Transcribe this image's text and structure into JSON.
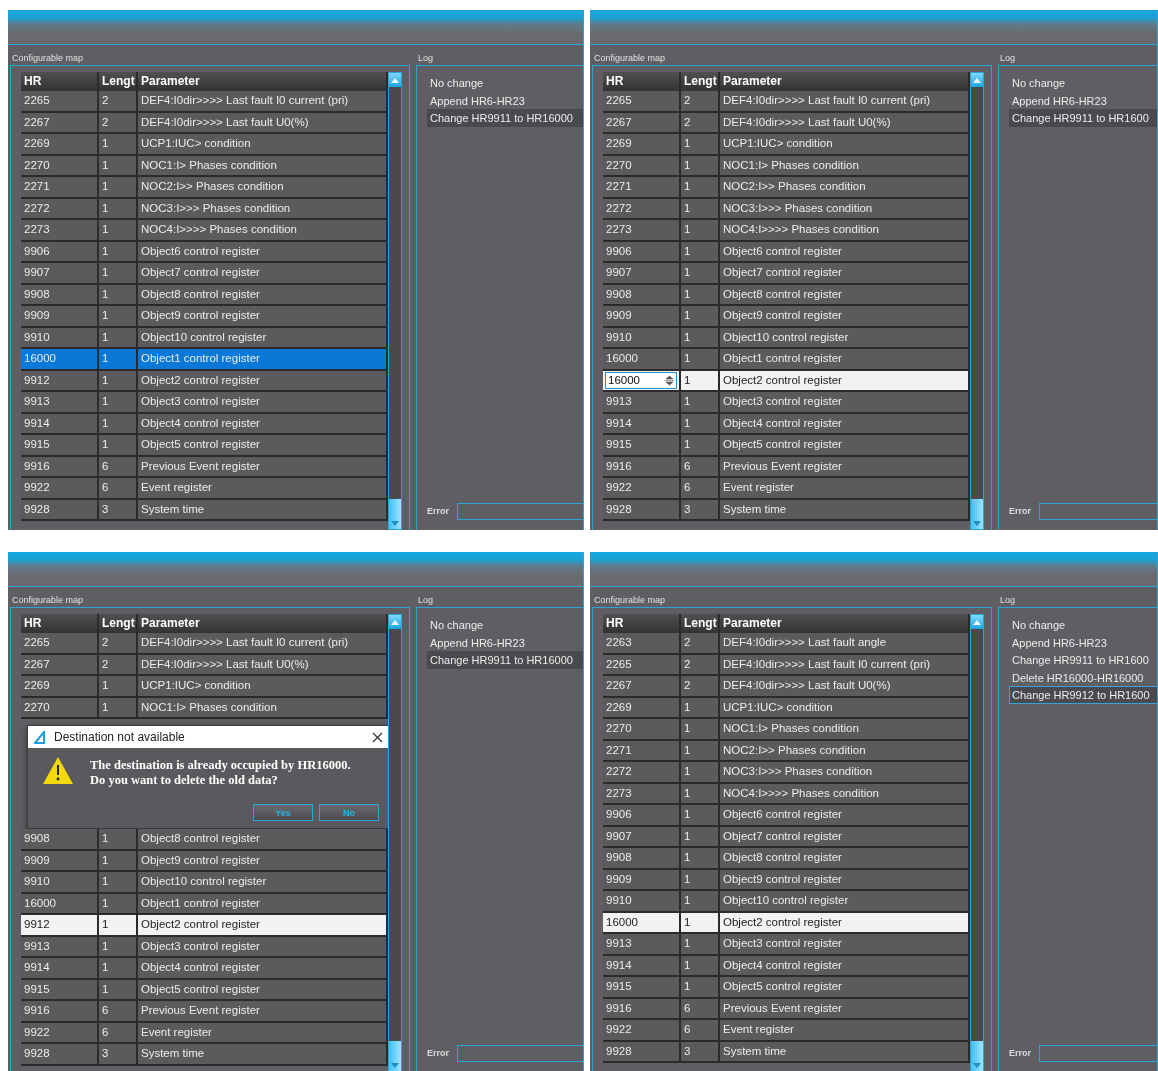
{
  "panels": [
    {
      "map_label": "Configurable map",
      "log_label": "Log",
      "table_focused": true,
      "log_focused": false,
      "error_label": "Error",
      "table": {
        "columns": [
          "HR",
          "Lengt",
          "Parameter"
        ],
        "rows": [
          {
            "kind": "row",
            "hr": "2265",
            "length": "2",
            "parameter": "DEF4:I0dir>>>> Last fault I0 current (pri)",
            "selected": false
          },
          {
            "kind": "row",
            "hr": "2267",
            "length": "2",
            "parameter": "DEF4:I0dir>>>> Last fault U0(%)",
            "selected": false
          },
          {
            "kind": "row",
            "hr": "2269",
            "length": "1",
            "parameter": "UCP1:IUC> condition",
            "selected": false
          },
          {
            "kind": "row",
            "hr": "2270",
            "length": "1",
            "parameter": "NOC1:I> Phases condition",
            "selected": false
          },
          {
            "kind": "row",
            "hr": "2271",
            "length": "1",
            "parameter": "NOC2:I>> Phases condition",
            "selected": false
          },
          {
            "kind": "row",
            "hr": "2272",
            "length": "1",
            "parameter": "NOC3:I>>> Phases condition",
            "selected": false
          },
          {
            "kind": "row",
            "hr": "2273",
            "length": "1",
            "parameter": "NOC4:I>>>> Phases condition",
            "selected": false
          },
          {
            "kind": "row",
            "hr": "9906",
            "length": "1",
            "parameter": "Object6 control register",
            "selected": false
          },
          {
            "kind": "row",
            "hr": "9907",
            "length": "1",
            "parameter": "Object7 control register",
            "selected": false
          },
          {
            "kind": "row",
            "hr": "9908",
            "length": "1",
            "parameter": "Object8 control register",
            "selected": false
          },
          {
            "kind": "row",
            "hr": "9909",
            "length": "1",
            "parameter": "Object9 control register",
            "selected": false
          },
          {
            "kind": "row",
            "hr": "9910",
            "length": "1",
            "parameter": "Object10 control register",
            "selected": false
          },
          {
            "kind": "row",
            "hr": "16000",
            "length": "1",
            "parameter": "Object1 control register",
            "selected": true
          },
          {
            "kind": "row",
            "hr": "9912",
            "length": "1",
            "parameter": "Object2 control register",
            "selected": false
          },
          {
            "kind": "row",
            "hr": "9913",
            "length": "1",
            "parameter": "Object3 control register",
            "selected": false
          },
          {
            "kind": "row",
            "hr": "9914",
            "length": "1",
            "parameter": "Object4 control register",
            "selected": false
          },
          {
            "kind": "row",
            "hr": "9915",
            "length": "1",
            "parameter": "Object5 control register",
            "selected": false
          },
          {
            "kind": "row",
            "hr": "9916",
            "length": "6",
            "parameter": "Previous Event register",
            "selected": false
          },
          {
            "kind": "row",
            "hr": "9922",
            "length": "6",
            "parameter": "Event register",
            "selected": false
          },
          {
            "kind": "row",
            "hr": "9928",
            "length": "3",
            "parameter": "System time",
            "selected": false
          }
        ]
      },
      "log": [
        {
          "text": "No change",
          "selected": false
        },
        {
          "text": "Append HR6-HR23",
          "selected": false
        },
        {
          "text": "Change HR9911 to HR16000",
          "selected": true
        }
      ]
    },
    {
      "map_label": "Configurable map",
      "log_label": "Log",
      "table_focused": false,
      "log_focused": false,
      "error_label": "Error",
      "table": {
        "columns": [
          "HR",
          "Lengt",
          "Parameter"
        ],
        "rows": [
          {
            "kind": "row",
            "hr": "2265",
            "length": "2",
            "parameter": "DEF4:I0dir>>>> Last fault I0 current (pri)",
            "selected": false
          },
          {
            "kind": "row",
            "hr": "2267",
            "length": "2",
            "parameter": "DEF4:I0dir>>>> Last fault U0(%)",
            "selected": false
          },
          {
            "kind": "row",
            "hr": "2269",
            "length": "1",
            "parameter": "UCP1:IUC> condition",
            "selected": false
          },
          {
            "kind": "row",
            "hr": "2270",
            "length": "1",
            "parameter": "NOC1:I> Phases condition",
            "selected": false
          },
          {
            "kind": "row",
            "hr": "2271",
            "length": "1",
            "parameter": "NOC2:I>> Phases condition",
            "selected": false
          },
          {
            "kind": "row",
            "hr": "2272",
            "length": "1",
            "parameter": "NOC3:I>>> Phases condition",
            "selected": false
          },
          {
            "kind": "row",
            "hr": "2273",
            "length": "1",
            "parameter": "NOC4:I>>>> Phases condition",
            "selected": false
          },
          {
            "kind": "row",
            "hr": "9906",
            "length": "1",
            "parameter": "Object6 control register",
            "selected": false
          },
          {
            "kind": "row",
            "hr": "9907",
            "length": "1",
            "parameter": "Object7 control register",
            "selected": false
          },
          {
            "kind": "row",
            "hr": "9908",
            "length": "1",
            "parameter": "Object8 control register",
            "selected": false
          },
          {
            "kind": "row",
            "hr": "9909",
            "length": "1",
            "parameter": "Object9 control register",
            "selected": false
          },
          {
            "kind": "row",
            "hr": "9910",
            "length": "1",
            "parameter": "Object10 control register",
            "selected": false
          },
          {
            "kind": "row",
            "hr": "16000",
            "length": "1",
            "parameter": "Object1 control register",
            "selected": false
          },
          {
            "kind": "editing",
            "hr": "16000",
            "length": "1",
            "parameter": "Object2 control register",
            "selected": true
          },
          {
            "kind": "row",
            "hr": "9913",
            "length": "1",
            "parameter": "Object3 control register",
            "selected": false
          },
          {
            "kind": "row",
            "hr": "9914",
            "length": "1",
            "parameter": "Object4 control register",
            "selected": false
          },
          {
            "kind": "row",
            "hr": "9915",
            "length": "1",
            "parameter": "Object5 control register",
            "selected": false
          },
          {
            "kind": "row",
            "hr": "9916",
            "length": "6",
            "parameter": "Previous Event register",
            "selected": false
          },
          {
            "kind": "row",
            "hr": "9922",
            "length": "6",
            "parameter": "Event register",
            "selected": false
          },
          {
            "kind": "row",
            "hr": "9928",
            "length": "3",
            "parameter": "System time",
            "selected": false
          }
        ]
      },
      "log": [
        {
          "text": "No change",
          "selected": false
        },
        {
          "text": "Append HR6-HR23",
          "selected": false
        },
        {
          "text": "Change HR9911 to HR1600",
          "selected": true
        }
      ]
    },
    {
      "map_label": "Configurable map",
      "log_label": "Log",
      "table_focused": false,
      "log_focused": false,
      "error_label": "Error",
      "table": {
        "columns": [
          "HR",
          "Lengt",
          "Parameter"
        ],
        "rows": [
          {
            "kind": "row",
            "hr": "2265",
            "length": "2",
            "parameter": "DEF4:I0dir>>>> Last fault I0 current (pri)",
            "selected": false
          },
          {
            "kind": "row",
            "hr": "2267",
            "length": "2",
            "parameter": "DEF4:I0dir>>>> Last fault U0(%)",
            "selected": false
          },
          {
            "kind": "row",
            "hr": "2269",
            "length": "1",
            "parameter": "UCP1:IUC> condition",
            "selected": false
          },
          {
            "kind": "row",
            "hr": "2270",
            "length": "1",
            "parameter": "NOC1:I> Phases condition",
            "selected": false
          },
          {
            "kind": "dialog",
            "title": "Destination not available",
            "message": "The destination is already occupied by HR16000.\nDo you want to delete the old data?",
            "buttons": [
              "Yes",
              "No"
            ]
          },
          {
            "kind": "row",
            "hr": "9908",
            "length": "1",
            "parameter": "Object8 control register",
            "selected": false
          },
          {
            "kind": "row",
            "hr": "9909",
            "length": "1",
            "parameter": "Object9 control register",
            "selected": false
          },
          {
            "kind": "row",
            "hr": "9910",
            "length": "1",
            "parameter": "Object10 control register",
            "selected": false
          },
          {
            "kind": "row",
            "hr": "16000",
            "length": "1",
            "parameter": "Object1 control register",
            "selected": false
          },
          {
            "kind": "row",
            "hr": "9912",
            "length": "1",
            "parameter": "Object2 control register",
            "selected": true
          },
          {
            "kind": "row",
            "hr": "9913",
            "length": "1",
            "parameter": "Object3 control register",
            "selected": false
          },
          {
            "kind": "row",
            "hr": "9914",
            "length": "1",
            "parameter": "Object4 control register",
            "selected": false
          },
          {
            "kind": "row",
            "hr": "9915",
            "length": "1",
            "parameter": "Object5 control register",
            "selected": false
          },
          {
            "kind": "row",
            "hr": "9916",
            "length": "6",
            "parameter": "Previous Event register",
            "selected": false
          },
          {
            "kind": "row",
            "hr": "9922",
            "length": "6",
            "parameter": "Event register",
            "selected": false
          },
          {
            "kind": "row",
            "hr": "9928",
            "length": "3",
            "parameter": "System time",
            "selected": false
          }
        ]
      },
      "log": [
        {
          "text": "No change",
          "selected": false
        },
        {
          "text": "Append HR6-HR23",
          "selected": false
        },
        {
          "text": "Change HR9911 to HR16000",
          "selected": true
        }
      ]
    },
    {
      "map_label": "Configurable map",
      "log_label": "Log",
      "table_focused": false,
      "log_focused": true,
      "error_label": "Error",
      "table": {
        "columns": [
          "HR",
          "Lengt",
          "Parameter"
        ],
        "rows": [
          {
            "kind": "row",
            "hr": "2263",
            "length": "2",
            "parameter": "DEF4:I0dir>>>> Last fault angle",
            "selected": false
          },
          {
            "kind": "row",
            "hr": "2265",
            "length": "2",
            "parameter": "DEF4:I0dir>>>> Last fault I0 current (pri)",
            "selected": false
          },
          {
            "kind": "row",
            "hr": "2267",
            "length": "2",
            "parameter": "DEF4:I0dir>>>> Last fault U0(%)",
            "selected": false
          },
          {
            "kind": "row",
            "hr": "2269",
            "length": "1",
            "parameter": "UCP1:IUC> condition",
            "selected": false
          },
          {
            "kind": "row",
            "hr": "2270",
            "length": "1",
            "parameter": "NOC1:I> Phases condition",
            "selected": false
          },
          {
            "kind": "row",
            "hr": "2271",
            "length": "1",
            "parameter": "NOC2:I>> Phases condition",
            "selected": false
          },
          {
            "kind": "row",
            "hr": "2272",
            "length": "1",
            "parameter": "NOC3:I>>> Phases condition",
            "selected": false
          },
          {
            "kind": "row",
            "hr": "2273",
            "length": "1",
            "parameter": "NOC4:I>>>> Phases condition",
            "selected": false
          },
          {
            "kind": "row",
            "hr": "9906",
            "length": "1",
            "parameter": "Object6 control register",
            "selected": false
          },
          {
            "kind": "row",
            "hr": "9907",
            "length": "1",
            "parameter": "Object7 control register",
            "selected": false
          },
          {
            "kind": "row",
            "hr": "9908",
            "length": "1",
            "parameter": "Object8 control register",
            "selected": false
          },
          {
            "kind": "row",
            "hr": "9909",
            "length": "1",
            "parameter": "Object9 control register",
            "selected": false
          },
          {
            "kind": "row",
            "hr": "9910",
            "length": "1",
            "parameter": "Object10 control register",
            "selected": false
          },
          {
            "kind": "row",
            "hr": "16000",
            "length": "1",
            "parameter": "Object2 control register",
            "selected": true
          },
          {
            "kind": "row",
            "hr": "9913",
            "length": "1",
            "parameter": "Object3 control register",
            "selected": false
          },
          {
            "kind": "row",
            "hr": "9914",
            "length": "1",
            "parameter": "Object4 control register",
            "selected": false
          },
          {
            "kind": "row",
            "hr": "9915",
            "length": "1",
            "parameter": "Object5 control register",
            "selected": false
          },
          {
            "kind": "row",
            "hr": "9916",
            "length": "6",
            "parameter": "Previous Event register",
            "selected": false
          },
          {
            "kind": "row",
            "hr": "9922",
            "length": "6",
            "parameter": "Event register",
            "selected": false
          },
          {
            "kind": "row",
            "hr": "9928",
            "length": "3",
            "parameter": "System time",
            "selected": false
          }
        ]
      },
      "log": [
        {
          "text": "No change",
          "selected": false
        },
        {
          "text": "Append HR6-HR23",
          "selected": false
        },
        {
          "text": "Change HR9911 to HR1600",
          "selected": false
        },
        {
          "text": "Delete HR16000-HR16000",
          "selected": false
        },
        {
          "text": "Change HR9912 to HR1600",
          "selected": true
        }
      ]
    }
  ]
}
